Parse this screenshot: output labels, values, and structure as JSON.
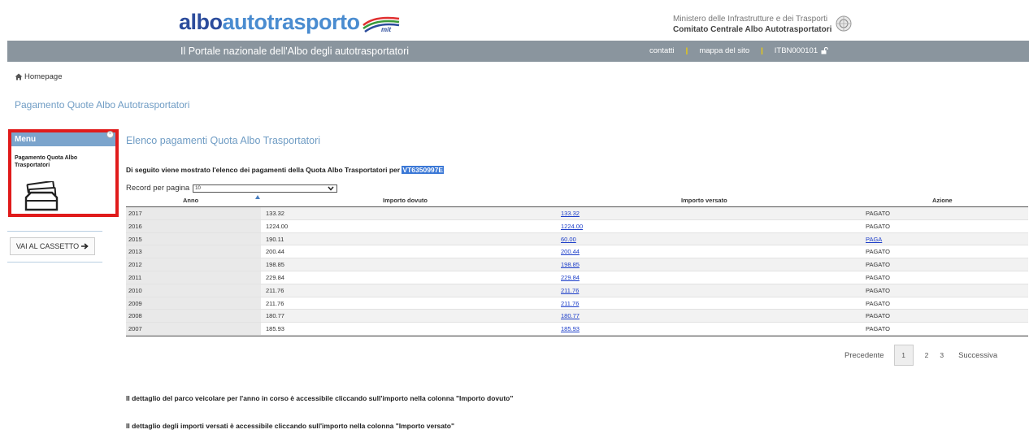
{
  "header": {
    "logo_part1": "albo",
    "logo_part2": "autotrasporto",
    "logo_badge": "mit",
    "ministry_line1": "Ministero delle Infrastrutture e dei Trasporti",
    "ministry_line2": "Comitato Centrale Albo Autotrasportatori"
  },
  "topbar": {
    "portal_title": "Il Portale nazionale dell'Albo degli autotrasportatori",
    "link_contatti": "contatti",
    "link_mappa": "mappa del sito",
    "user_code": "ITBN000101",
    "separator": "|"
  },
  "breadcrumb": {
    "home": "Homepage"
  },
  "page_title": "Pagamento Quote Albo Autotrasportatori",
  "sidebar": {
    "menu_title": "Menu",
    "menu_item": "Pagamento Quota Albo Trasportatori",
    "cassetto_label": "VAI AL CASSETTO"
  },
  "content": {
    "section_title": "Elenco pagamenti Quota Albo Trasportatori",
    "intro_text": "Di seguito viene mostrato l'elenco dei pagamenti della Quota Albo Trasportatori per ",
    "intro_code": "VT6350997E",
    "records_label": "Record per pagina",
    "records_value": "10"
  },
  "table": {
    "headers": [
      "Anno",
      "Importo dovuto",
      "Importo versato",
      "Azione"
    ],
    "rows": [
      {
        "anno": "2017",
        "dovuto": "133.32",
        "versato": "133.32",
        "azione": "PAGATO"
      },
      {
        "anno": "2016",
        "dovuto": "1224.00",
        "versato": "1224.00",
        "azione": "PAGATO"
      },
      {
        "anno": "2015",
        "dovuto": "190.11",
        "versato": "60.00",
        "azione": "PAGA"
      },
      {
        "anno": "2013",
        "dovuto": "200.44",
        "versato": "200.44",
        "azione": "PAGATO"
      },
      {
        "anno": "2012",
        "dovuto": "198.85",
        "versato": "198.85",
        "azione": "PAGATO"
      },
      {
        "anno": "2011",
        "dovuto": "229.84",
        "versato": "229.84",
        "azione": "PAGATO"
      },
      {
        "anno": "2010",
        "dovuto": "211.76",
        "versato": "211.76",
        "azione": "PAGATO"
      },
      {
        "anno": "2009",
        "dovuto": "211.76",
        "versato": "211.76",
        "azione": "PAGATO"
      },
      {
        "anno": "2008",
        "dovuto": "180.77",
        "versato": "180.77",
        "azione": "PAGATO"
      },
      {
        "anno": "2007",
        "dovuto": "185.93",
        "versato": "185.93",
        "azione": "PAGATO"
      }
    ]
  },
  "pagination": {
    "prev": "Precedente",
    "current": "1",
    "page2": "2",
    "page3": "3",
    "next": "Successiva"
  },
  "notes": {
    "note1": "Il dettaglio del parco veicolare per l'anno in corso è accessibile cliccando sull'importo nella colonna \"Importo dovuto\"",
    "note2": "Il dettaglio degli importi versati è accessibile cliccando sull'importo nella colonna \"Importo versato\""
  },
  "icons": [
    "home-icon",
    "unlock-icon",
    "arrow-right-icon",
    "sort-asc-icon",
    "chevron-down-icon",
    "inbox-tray-icon",
    "truck-logo-icon",
    "ministry-seal-icon"
  ],
  "colors": {
    "topbar": "#8a959e",
    "accent_title": "#6f9cc4",
    "menu_head": "#7ba4cc",
    "highlight_border": "#e01b1b",
    "link": "#1a3cc8",
    "separator": "#f2d000"
  }
}
